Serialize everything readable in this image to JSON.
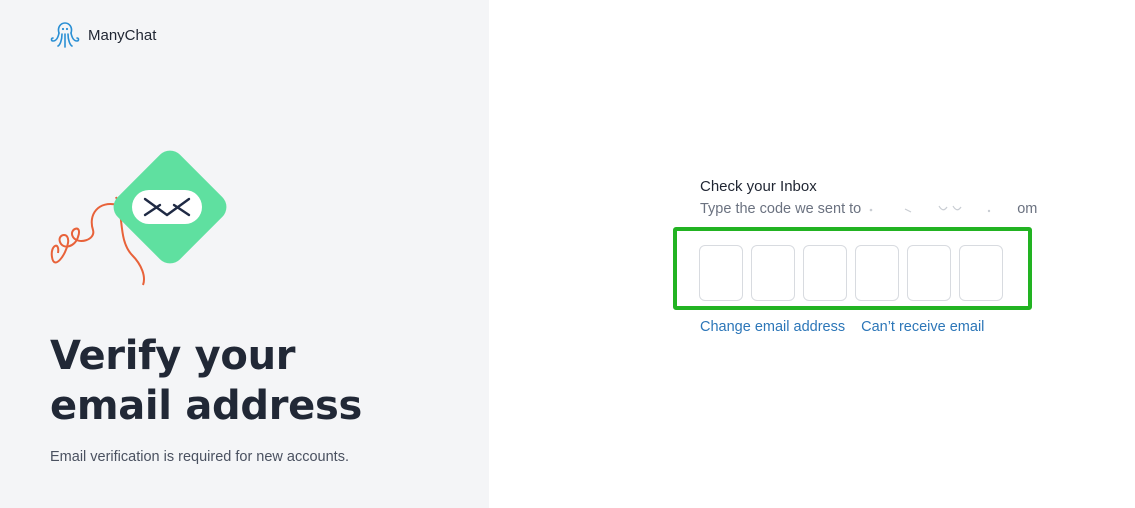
{
  "brand": {
    "name": "ManyChat",
    "logo_icon": "manychat-octopus-icon"
  },
  "hero": {
    "headline_line1": "Verify your",
    "headline_line2": "email address",
    "subtext": "Email verification is required for new accounts.",
    "illustration_icon": "envelope-icon"
  },
  "verify": {
    "title": "Check your Inbox",
    "description": "Type the code we sent to",
    "email_visible_tail": "om",
    "code_length": 6,
    "code_values": [
      "",
      "",
      "",
      "",
      "",
      ""
    ],
    "links": {
      "change_email": "Change email address",
      "cant_receive": "Can’t receive email"
    }
  },
  "colors": {
    "left_bg": "#f4f5f7",
    "highlight_border": "#22b322",
    "link": "#2c76b8",
    "brand_green": "#5fe0a0",
    "scribble": "#e8623a",
    "logo_blue": "#2a8fd4"
  }
}
